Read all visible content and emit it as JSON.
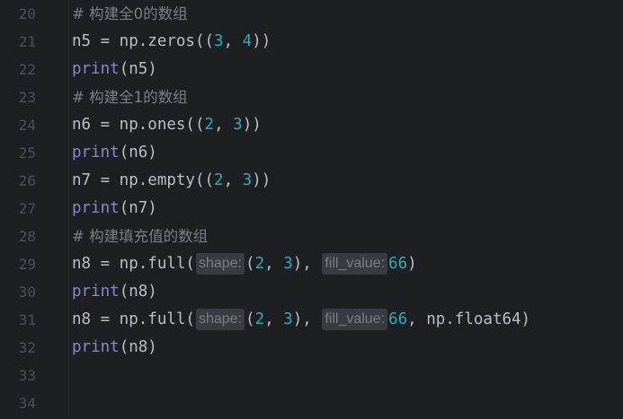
{
  "editor": {
    "lines": [
      {
        "n": "20",
        "tokens": [
          {
            "t": "comment",
            "v": "# 构建全0的数组"
          }
        ]
      },
      {
        "n": "21",
        "tokens": [
          {
            "t": "plain",
            "v": "n5 = np.zeros(("
          },
          {
            "t": "num",
            "v": "3"
          },
          {
            "t": "plain",
            "v": ", "
          },
          {
            "t": "num",
            "v": "4"
          },
          {
            "t": "plain",
            "v": "))"
          }
        ]
      },
      {
        "n": "22",
        "tokens": [
          {
            "t": "print",
            "v": "print"
          },
          {
            "t": "plain",
            "v": "(n5)"
          }
        ]
      },
      {
        "n": "23",
        "tokens": [
          {
            "t": "comment",
            "v": "# 构建全1的数组"
          }
        ]
      },
      {
        "n": "24",
        "tokens": [
          {
            "t": "plain",
            "v": "n6 = np.ones(("
          },
          {
            "t": "num",
            "v": "2"
          },
          {
            "t": "plain",
            "v": ", "
          },
          {
            "t": "num",
            "v": "3"
          },
          {
            "t": "plain",
            "v": "))"
          }
        ]
      },
      {
        "n": "25",
        "tokens": [
          {
            "t": "print",
            "v": "print"
          },
          {
            "t": "plain",
            "v": "(n6)"
          }
        ]
      },
      {
        "n": "26",
        "tokens": [
          {
            "t": "plain",
            "v": "n7 = np.empty(("
          },
          {
            "t": "num",
            "v": "2"
          },
          {
            "t": "plain",
            "v": ", "
          },
          {
            "t": "num",
            "v": "3"
          },
          {
            "t": "plain",
            "v": "))"
          }
        ]
      },
      {
        "n": "27",
        "tokens": [
          {
            "t": "print",
            "v": "print"
          },
          {
            "t": "plain",
            "v": "(n7)"
          }
        ]
      },
      {
        "n": "28",
        "tokens": [
          {
            "t": "comment",
            "v": "# 构建填充值的数组"
          }
        ]
      },
      {
        "n": "29",
        "tokens": [
          {
            "t": "plain",
            "v": "n8 = np.full("
          },
          {
            "t": "hint",
            "v": "shape:"
          },
          {
            "t": "plain",
            "v": "("
          },
          {
            "t": "num",
            "v": "2"
          },
          {
            "t": "plain",
            "v": ", "
          },
          {
            "t": "num",
            "v": "3"
          },
          {
            "t": "plain",
            "v": "), "
          },
          {
            "t": "hint",
            "v": "fill_value:"
          },
          {
            "t": "num",
            "v": "66"
          },
          {
            "t": "plain",
            "v": ")"
          }
        ]
      },
      {
        "n": "30",
        "tokens": [
          {
            "t": "print",
            "v": "print"
          },
          {
            "t": "plain",
            "v": "(n8)"
          }
        ]
      },
      {
        "n": "31",
        "tokens": [
          {
            "t": "plain",
            "v": "n8 = np.full("
          },
          {
            "t": "hint",
            "v": "shape:"
          },
          {
            "t": "plain",
            "v": "("
          },
          {
            "t": "num",
            "v": "2"
          },
          {
            "t": "plain",
            "v": ", "
          },
          {
            "t": "num",
            "v": "3"
          },
          {
            "t": "plain",
            "v": "), "
          },
          {
            "t": "hint",
            "v": "fill_value:"
          },
          {
            "t": "num",
            "v": "66"
          },
          {
            "t": "plain",
            "v": ", np.float64)"
          }
        ]
      },
      {
        "n": "32",
        "tokens": [
          {
            "t": "print",
            "v": "print"
          },
          {
            "t": "plain",
            "v": "(n8)"
          }
        ]
      },
      {
        "n": "33",
        "tokens": []
      },
      {
        "n": "34",
        "tokens": []
      }
    ]
  },
  "colors": {
    "background": "#1e1f22",
    "line_number": "#4b5059",
    "code": "#bcbec4",
    "print_builtin": "#8888c6",
    "number": "#2aacb8",
    "comment": "#7a7e85",
    "inlay_hint_bg": "#393b40"
  }
}
